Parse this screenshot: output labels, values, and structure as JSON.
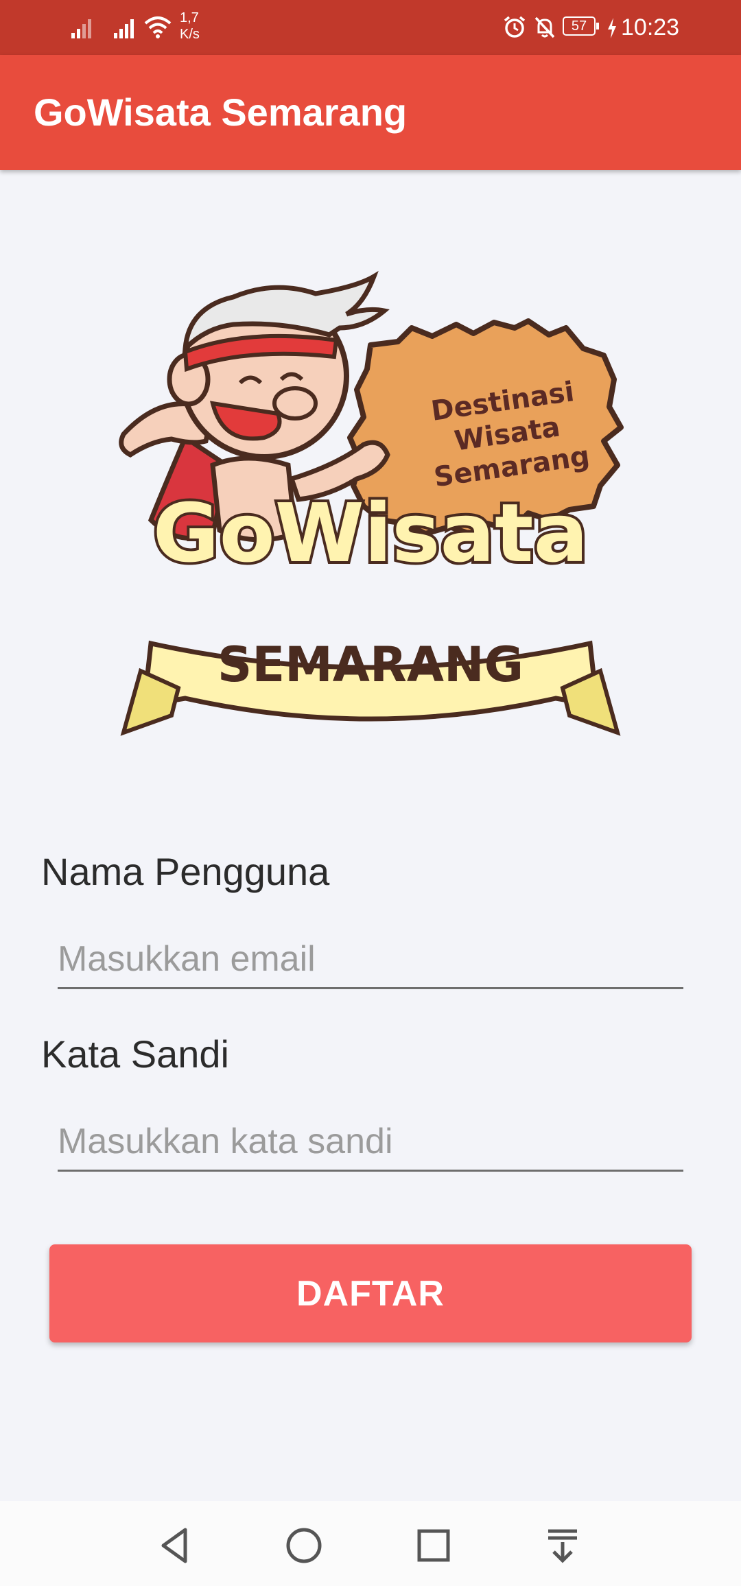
{
  "status_bar": {
    "net_speed_value": "1,7",
    "net_speed_unit": "K/s",
    "battery": "57",
    "time": "10:23",
    "icons": [
      "signal-icon",
      "signal-icon",
      "wifi-icon",
      "alarm-icon",
      "mute-icon",
      "battery-icon",
      "charging-icon"
    ]
  },
  "app_bar": {
    "title": "GoWisata Semarang"
  },
  "logo": {
    "brand_top": "GoWisata",
    "brand_bottom": "SEMARANG",
    "tagline_1": "Destinasi",
    "tagline_2": "Wisata",
    "tagline_3": "Semarang"
  },
  "form": {
    "username_label": "Nama Pengguna",
    "email_value": "",
    "email_placeholder": "Masukkan email",
    "password_label": "Kata Sandi",
    "password_value": "",
    "password_placeholder": "Masukkan kata sandi",
    "submit_label": "DAFTAR"
  },
  "nav_bar": {
    "icons": [
      "back-icon",
      "home-icon",
      "recents-icon",
      "notification-pulldown-icon"
    ]
  },
  "colors": {
    "status_bar": "#c1392b",
    "app_bar": "#e84c3d",
    "button": "#f76262",
    "background": "#f3f4f9"
  }
}
